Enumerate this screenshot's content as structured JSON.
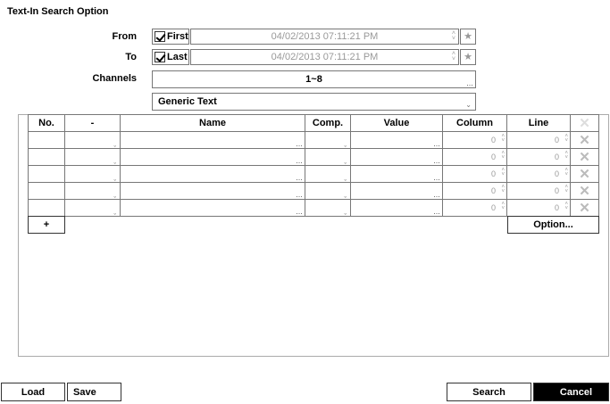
{
  "dialog": {
    "title": "Text-In Search Option"
  },
  "from": {
    "label": "From",
    "check_label": "First",
    "datetime": "04/02/2013  07:11:21 PM"
  },
  "to": {
    "label": "To",
    "check_label": "Last",
    "datetime": "04/02/2013  07:11:21 PM"
  },
  "channels": {
    "label": "Channels",
    "value": "1~8"
  },
  "text_type": {
    "value": "Generic Text"
  },
  "table": {
    "headers": [
      "No.",
      "-",
      "Name",
      "Comp.",
      "Value",
      "Column",
      "Line"
    ],
    "rows": [
      {
        "column": "0",
        "line": "0"
      },
      {
        "column": "0",
        "line": "0"
      },
      {
        "column": "0",
        "line": "0"
      },
      {
        "column": "0",
        "line": "0"
      },
      {
        "column": "0",
        "line": "0"
      }
    ]
  },
  "buttons": {
    "add": "+",
    "option": "Option...",
    "load": "Load",
    "save": "Save",
    "search": "Search",
    "cancel": "Cancel"
  }
}
